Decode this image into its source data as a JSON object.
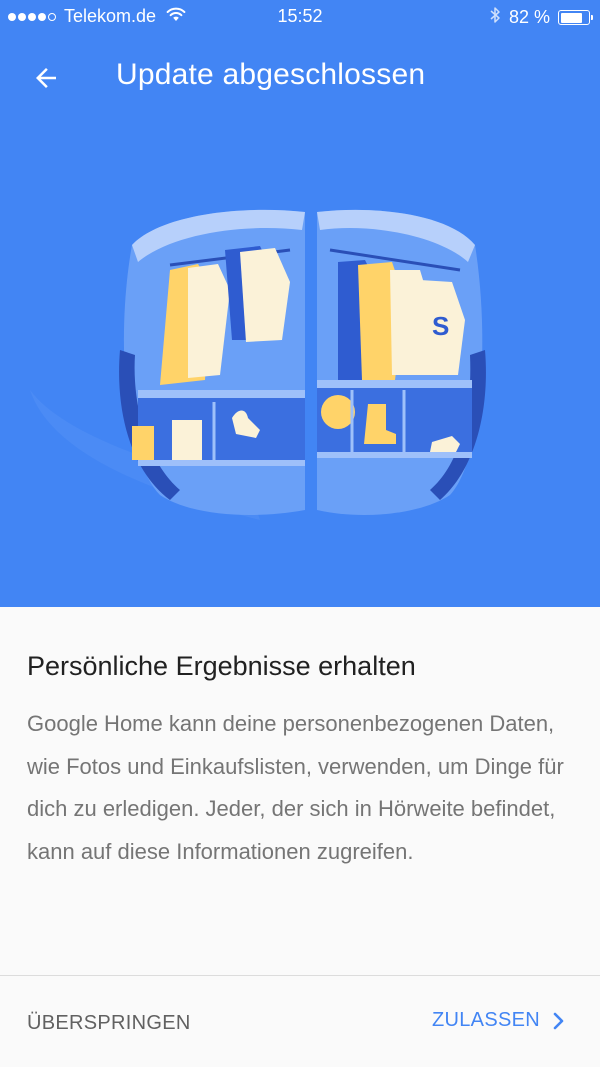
{
  "status_bar": {
    "carrier": "Telekom.de",
    "time": "15:52",
    "battery_text": "82 %",
    "battery_level": 0.82,
    "signal_dots_filled": 4,
    "signal_dots_total": 5
  },
  "app_bar": {
    "back_icon": "arrow-back-icon",
    "title": "Update abgeschlossen"
  },
  "illustration": {
    "subject": "google-home-wardrobe-illustration"
  },
  "content": {
    "heading": "Persönliche Ergebnisse erhalten",
    "body": "Google Home kann deine personenbezogenen Daten, wie Fotos und Einkaufslisten, verwenden, um Dinge für dich zu erledigen. Jeder, der sich in Hörweite befindet, kann auf diese Informationen zugreifen."
  },
  "footer": {
    "skip_label": "ÜBERSPRINGEN",
    "allow_label": "ZULASSEN",
    "allow_icon": "chevron-right-icon"
  },
  "colors": {
    "primary": "#4285f4",
    "heading_text": "#212121",
    "body_text": "#757575",
    "skip_text": "#616161",
    "background": "#fafafa"
  }
}
